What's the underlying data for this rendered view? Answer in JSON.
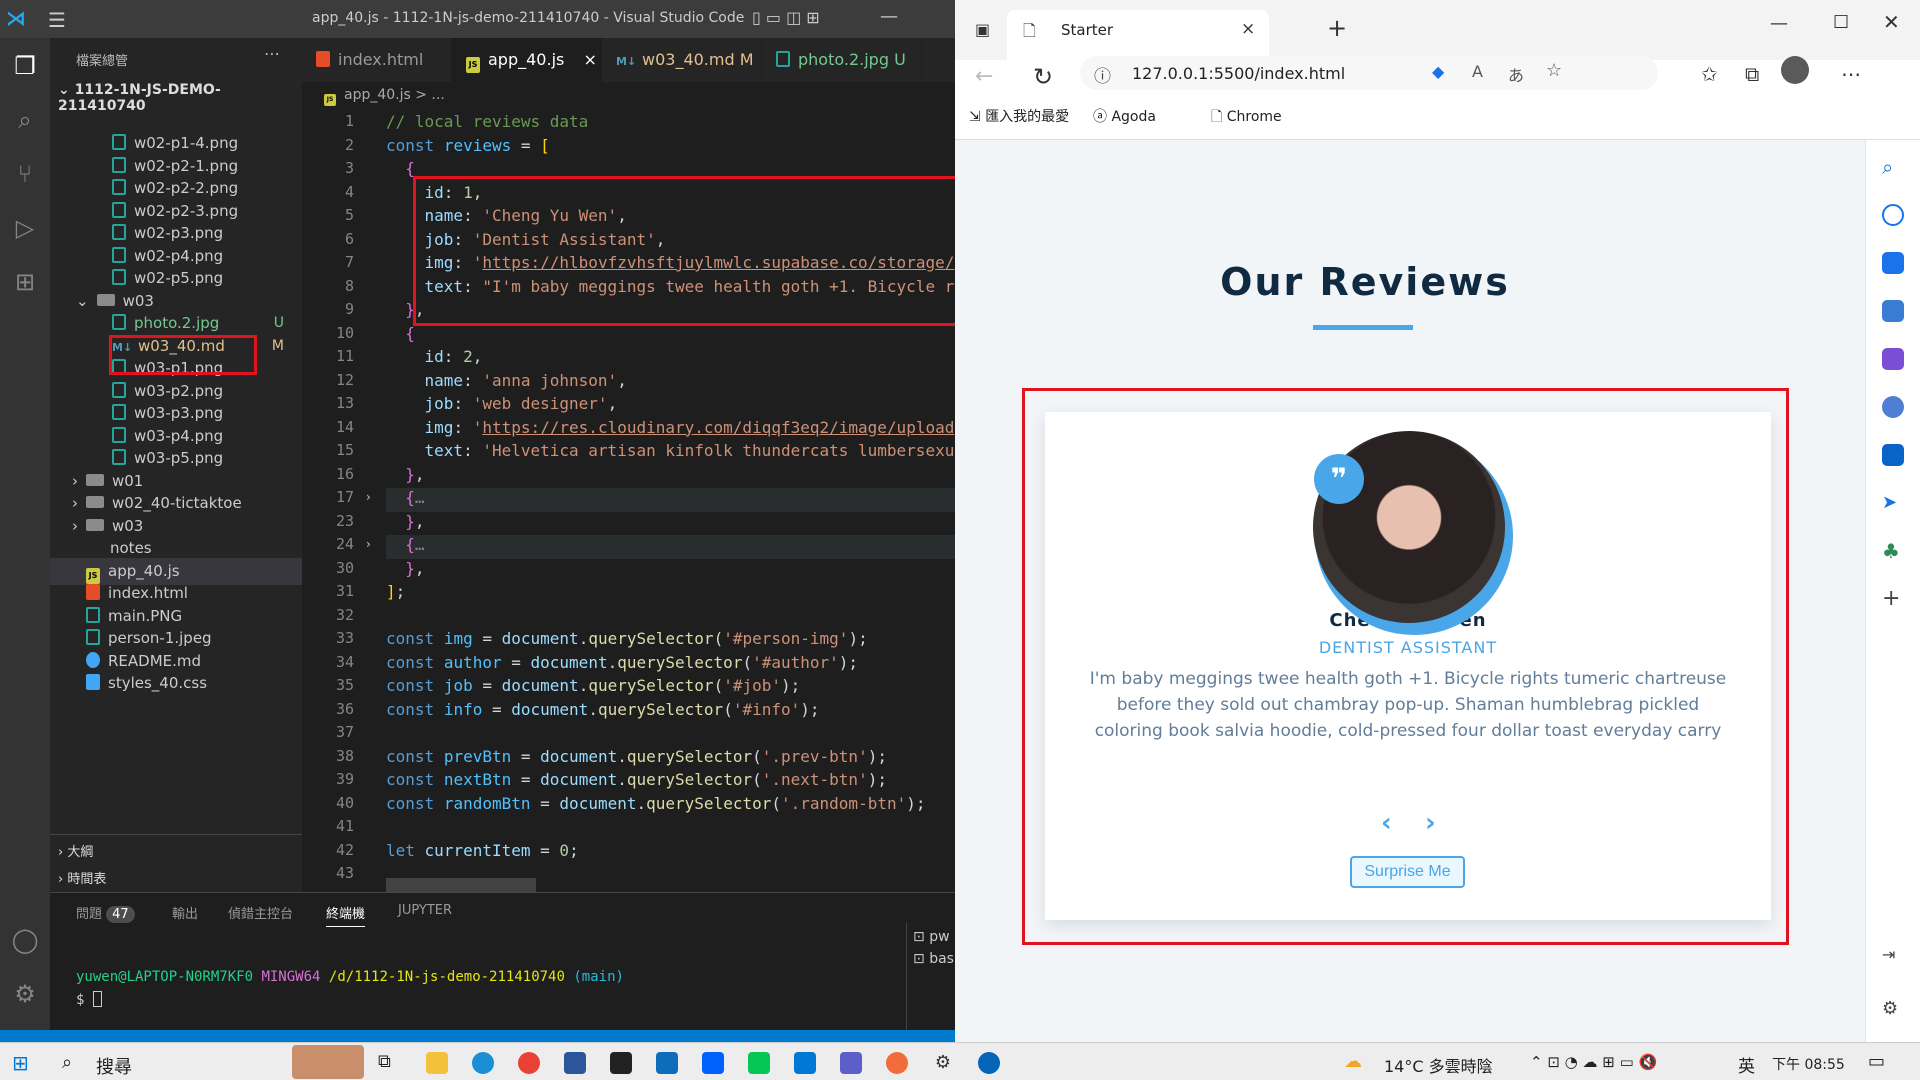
{
  "vscode": {
    "title": "app_40.js - 1112-1N-js-demo-211410740 - Visual Studio Code",
    "explorer_title": "檔案總管",
    "root_folder": "1112-1N-JS-DEMO-211410740",
    "tree": [
      {
        "name": "w02-p1-4.png",
        "type": "png"
      },
      {
        "name": "w02-p2-1.png",
        "type": "png"
      },
      {
        "name": "w02-p2-2.png",
        "type": "png"
      },
      {
        "name": "w02-p2-3.png",
        "type": "png"
      },
      {
        "name": "w02-p3.png",
        "type": "png"
      },
      {
        "name": "w02-p4.png",
        "type": "png"
      },
      {
        "name": "w02-p5.png",
        "type": "png"
      },
      {
        "name": "w03",
        "type": "folder-open"
      },
      {
        "name": "photo.2.jpg",
        "type": "png",
        "badge": "U"
      },
      {
        "name": "w03_40.md",
        "type": "md",
        "badge": "M"
      },
      {
        "name": "w03-p1.png",
        "type": "png"
      },
      {
        "name": "w03-p2.png",
        "type": "png"
      },
      {
        "name": "w03-p3.png",
        "type": "png"
      },
      {
        "name": "w03-p4.png",
        "type": "png"
      },
      {
        "name": "w03-p5.png",
        "type": "png"
      },
      {
        "name": "w01",
        "type": "folder"
      },
      {
        "name": "w02_40-tictaktoe",
        "type": "folder"
      },
      {
        "name": "w03",
        "type": "folder"
      },
      {
        "name": "notes",
        "type": "text"
      },
      {
        "name": "app_40.js",
        "type": "js"
      },
      {
        "name": "index.html",
        "type": "html"
      },
      {
        "name": "main.PNG",
        "type": "png"
      },
      {
        "name": "person-1.jpeg",
        "type": "png"
      },
      {
        "name": "README.md",
        "type": "info"
      },
      {
        "name": "styles_40.css",
        "type": "css"
      }
    ],
    "outline_label": "大綱",
    "timeline_label": "時間表",
    "tabs": [
      {
        "label": "index.html",
        "flag": ""
      },
      {
        "label": "app_40.js",
        "flag": "×"
      },
      {
        "label": "w03_40.md",
        "flag": "M"
      },
      {
        "label": "photo.2.jpg",
        "flag": "U"
      }
    ],
    "breadcrumb": "app_40.js > ...",
    "panel_tabs": [
      "問題",
      "輸出",
      "偵錯主控台",
      "終端機",
      "JUPYTER"
    ],
    "problems_count": "47",
    "terminal_user": "yuwen@LAPTOP-N0RM7KF0",
    "terminal_env": "MINGW64",
    "terminal_path": "/d/1112-1N-js-demo-211410740",
    "terminal_branch": "(main)",
    "terminal_prompt": "$",
    "terminal_side": [
      "pw",
      "bas"
    ]
  },
  "browser": {
    "tab_title": "Starter",
    "url": "127.0.0.1:5500/index.html",
    "favorites": [
      "匯入我的最愛",
      "Agoda",
      "Chrome"
    ],
    "page_title": "Our Reviews",
    "review": {
      "name": "Cheng Yu Wen",
      "job": "DENTIST ASSISTANT",
      "text": "I'm baby meggings twee health goth +1. Bicycle rights tumeric chartreuse before they sold out chambray pop-up. Shaman humblebrag pickled coloring book salvia hoodie, cold-pressed four dollar toast everyday carry",
      "button": "Surprise Me"
    },
    "accent_color": "#49a6e9"
  },
  "taskbar": {
    "search": "搜尋",
    "weather": "14°C 多雲時陰",
    "ime": "英",
    "clock": "下午 08:55"
  }
}
